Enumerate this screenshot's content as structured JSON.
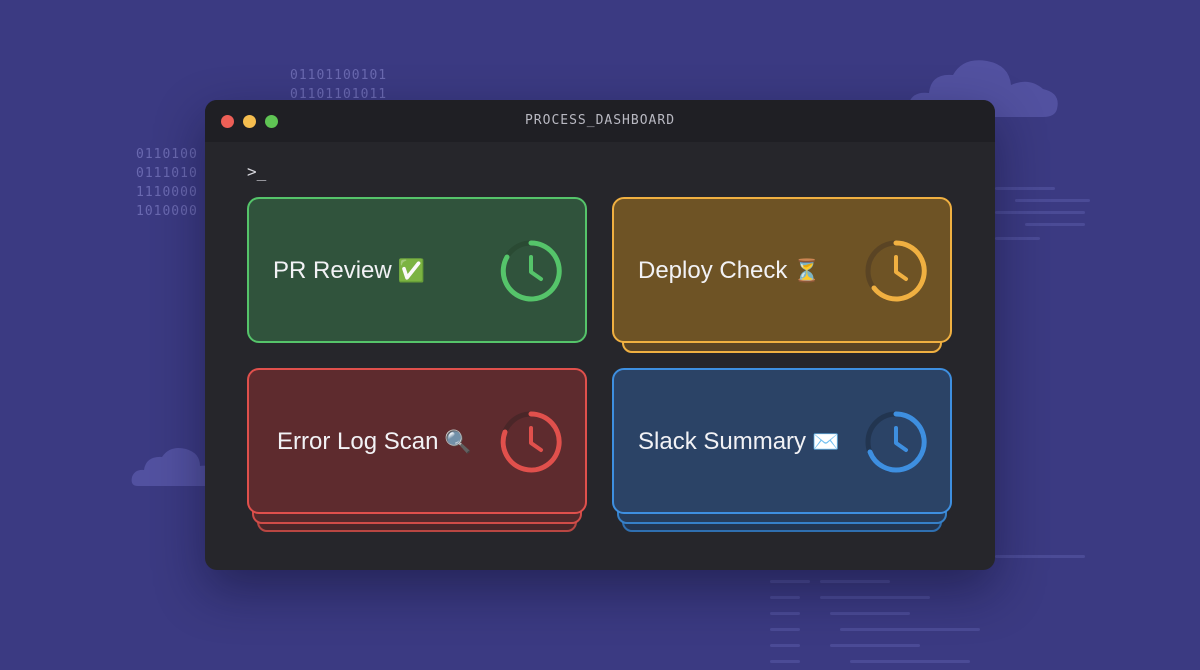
{
  "background": {
    "color": "#3b3a82",
    "binary_lines": {
      "top": [
        "01101100101",
        "01101101011"
      ],
      "left": [
        "0110100",
        "0111010",
        "1110000",
        "1010000"
      ]
    }
  },
  "window": {
    "title": "PROCESS_DASHBOARD",
    "prompt": ">_",
    "controls": {
      "close_color": "#ed5f57",
      "minimize_color": "#f5bd4f",
      "maximize_color": "#5fc454"
    }
  },
  "cards": [
    {
      "label": "PR Review",
      "emoji": "✅",
      "color": "#55c46a",
      "fill": "#30533c",
      "icon": "clock-icon"
    },
    {
      "label": "Deploy Check",
      "emoji": "⏳",
      "color": "#f0b041",
      "fill": "#6e5325",
      "icon": "clock-icon"
    },
    {
      "label": "Error Log Scan",
      "emoji": "🔍",
      "color": "#e0504c",
      "fill": "#5e2b2e",
      "icon": "clock-icon"
    },
    {
      "label": "Slack Summary",
      "emoji": "✉️",
      "color": "#3e8fe0",
      "fill": "#2b4366",
      "icon": "clock-icon"
    }
  ]
}
